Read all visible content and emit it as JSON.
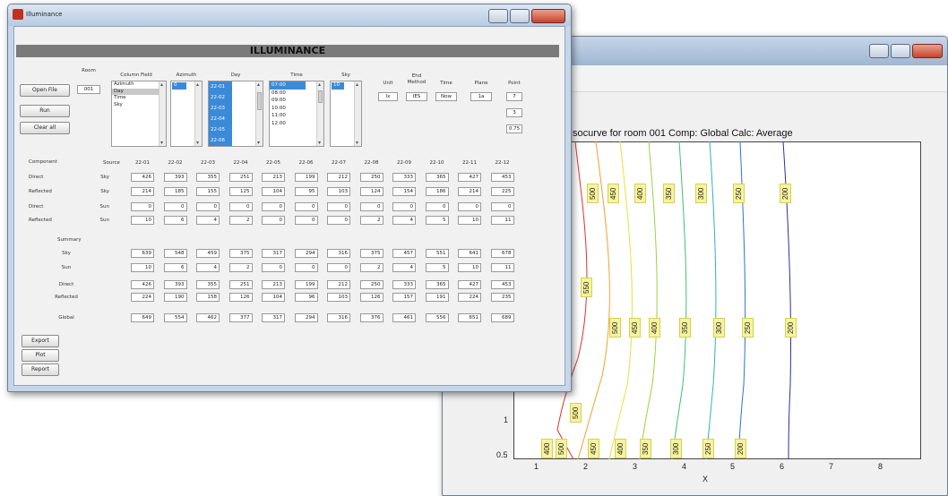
{
  "plot_window": {
    "title": "Isocurve for room 001 Comp: Global Calc: Average",
    "toolbar": [
      {
        "icon": "pan-icon",
        "glyph": "✋"
      },
      {
        "icon": "rotate-icon",
        "glyph": "⟲"
      },
      {
        "icon": "data-cursor-icon",
        "glyph": "⌖"
      },
      {
        "icon": "colorbar-icon",
        "glyph": "▯"
      },
      {
        "icon": "legend-icon",
        "glyph": "▦"
      }
    ],
    "x_ticks": [
      "1",
      "2",
      "3",
      "4",
      "5",
      "6",
      "7",
      "8"
    ],
    "y_ticks": [
      "1",
      "0.5"
    ],
    "x_label": "X",
    "contour_labels": [
      "500",
      "450",
      "400",
      "350",
      "300",
      "250",
      "200",
      "550",
      "500",
      "450",
      "400",
      "350",
      "300",
      "250",
      "200",
      "500",
      "400",
      "500",
      "450",
      "400",
      "350",
      "300",
      "250",
      "200"
    ]
  },
  "illum": {
    "title": "Illuminance",
    "banner": "ILLUMINANCE",
    "buttons": {
      "open": "Open File",
      "run": "Run",
      "clear": "Clear all",
      "export": "Export",
      "plot": "Plot",
      "report": "Report"
    },
    "room_label": "Room",
    "room_value": "001",
    "column_field_label": "Column Field",
    "column_field_items": [
      "Azimuth",
      "Day",
      "Time",
      "Sky"
    ],
    "azimuth_label": "Azimuth",
    "azimuth_items": [
      "0"
    ],
    "day_label": "Day",
    "day_items": [
      "22-01",
      "22-02",
      "22-03",
      "22-04",
      "22-05",
      "22-06"
    ],
    "time_label": "Time",
    "time_items": [
      "07:00",
      "08:00",
      "09:00",
      "10:00",
      "11:00",
      "12:00"
    ],
    "sky_label": "Sky",
    "sky_items": [
      "10"
    ],
    "unit_label": "Unit",
    "unit_value": "lx",
    "ehd_label": "Ehd Method",
    "ehd_value": "IES",
    "time2_label": "Time",
    "time2_value": "Now",
    "plane_label": "Plane",
    "plane_value": "1a",
    "point_label": "Point",
    "point_values": [
      "7",
      "3",
      "0.75"
    ],
    "component_header": "Component",
    "source_header": "Source",
    "days": [
      "22-01",
      "22-02",
      "22-03",
      "22-04",
      "22-05",
      "22-06",
      "22-07",
      "22-08",
      "22-09",
      "22-10",
      "22-11",
      "22-12"
    ],
    "rows": [
      {
        "component": "Direct",
        "source": "Sky",
        "values": [
          "426",
          "393",
          "355",
          "251",
          "213",
          "199",
          "212",
          "250",
          "333",
          "365",
          "427",
          "453"
        ]
      },
      {
        "component": "Reflected",
        "source": "Sky",
        "values": [
          "214",
          "185",
          "155",
          "125",
          "104",
          "95",
          "103",
          "124",
          "154",
          "186",
          "214",
          "225"
        ]
      },
      {
        "component": "Direct",
        "source": "Sun",
        "values": [
          "0",
          "0",
          "0",
          "0",
          "0",
          "0",
          "0",
          "0",
          "0",
          "0",
          "0",
          "0"
        ]
      },
      {
        "component": "Reflected",
        "source": "Sun",
        "values": [
          "10",
          "6",
          "4",
          "2",
          "0",
          "0",
          "0",
          "2",
          "4",
          "5",
          "10",
          "11"
        ]
      }
    ],
    "summary_label": "Summary",
    "summary_rows": [
      {
        "label": "Sky",
        "values": [
          "639",
          "548",
          "459",
          "375",
          "317",
          "294",
          "316",
          "375",
          "457",
          "551",
          "641",
          "678"
        ]
      },
      {
        "label": "Sun",
        "values": [
          "10",
          "6",
          "4",
          "2",
          "0",
          "0",
          "0",
          "2",
          "4",
          "5",
          "10",
          "11"
        ]
      },
      {
        "label": "Direct",
        "values": [
          "426",
          "393",
          "355",
          "251",
          "213",
          "199",
          "212",
          "250",
          "333",
          "365",
          "427",
          "453"
        ]
      },
      {
        "label": "Reflected",
        "values": [
          "224",
          "190",
          "158",
          "126",
          "104",
          "96",
          "103",
          "126",
          "157",
          "191",
          "224",
          "235"
        ]
      },
      {
        "label": "Global",
        "values": [
          "649",
          "554",
          "462",
          "377",
          "317",
          "294",
          "316",
          "376",
          "461",
          "556",
          "651",
          "689"
        ]
      }
    ]
  }
}
